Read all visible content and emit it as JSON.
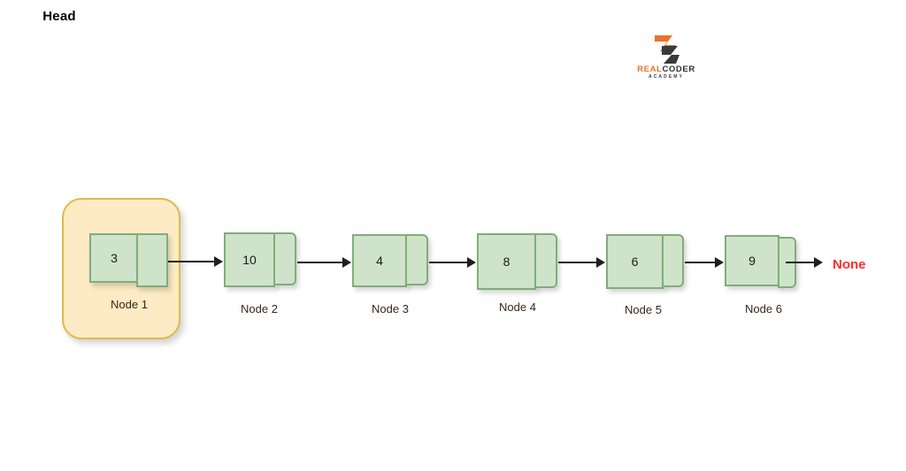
{
  "logo": {
    "name": "real-coder-academy-logo",
    "word_real": "REAL",
    "word_coder": "CODER",
    "word_academy": "ACADEMY",
    "color_orange": "#E8732A",
    "color_dark": "#2F2F2F"
  },
  "diagram": {
    "type": "singly-linked-list",
    "head_label": "Head",
    "terminator": "None",
    "terminator_color": "#FF2D2D",
    "node_fill": "#CFE3CB",
    "node_border": "#7FAE78",
    "head_fill": "#FCEBC4",
    "head_border": "#E0B94A",
    "label_color": "#3B241C",
    "nodes": [
      {
        "value": "3",
        "label": "Node 1"
      },
      {
        "value": "10",
        "label": "Node 2"
      },
      {
        "value": "4",
        "label": "Node 3"
      },
      {
        "value": "8",
        "label": "Node 4"
      },
      {
        "value": "6",
        "label": "Node 5"
      },
      {
        "value": "9",
        "label": "Node 6"
      }
    ]
  }
}
